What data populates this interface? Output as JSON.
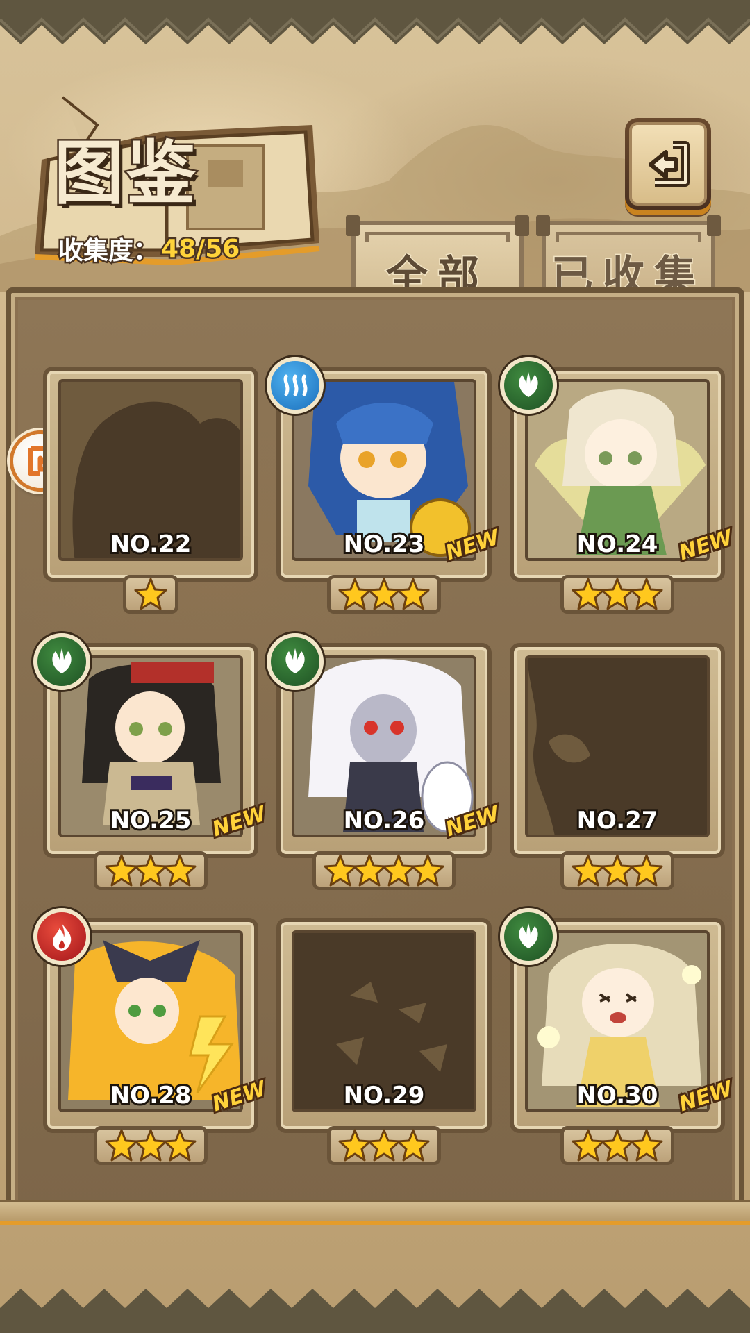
{
  "header": {
    "title": "图鉴",
    "collect_label": "收集度：",
    "collect_value": "48/56"
  },
  "tabs": [
    {
      "label": "全部",
      "active": true
    },
    {
      "label": "已收集",
      "active": false
    }
  ],
  "icons": {
    "back": "back-return-icon",
    "side_arrow": "prev-page-arrow-icon",
    "water": "water-element-icon",
    "nature": "nature-leaf-element-icon",
    "fire": "fire-element-icon",
    "star": "star-icon"
  },
  "colors": {
    "accent_orange": "#e49c2a",
    "gold_text": "#ffd43a",
    "frame_brown": "#6a5439",
    "water": "#1b6fbc",
    "nature": "#1f5224",
    "fire": "#a3161a"
  },
  "new_badge_label": "NEW",
  "cards": [
    {
      "number": "NO.22",
      "stars": 1,
      "element": null,
      "new": false,
      "collected": false
    },
    {
      "number": "NO.23",
      "stars": 3,
      "element": "water",
      "new": true,
      "collected": true
    },
    {
      "number": "NO.24",
      "stars": 3,
      "element": "nature",
      "new": true,
      "collected": true
    },
    {
      "number": "NO.25",
      "stars": 3,
      "element": "nature",
      "new": true,
      "collected": true
    },
    {
      "number": "NO.26",
      "stars": 4,
      "element": "nature",
      "new": true,
      "collected": true
    },
    {
      "number": "NO.27",
      "stars": 3,
      "element": null,
      "new": false,
      "collected": false
    },
    {
      "number": "NO.28",
      "stars": 3,
      "element": "fire",
      "new": true,
      "collected": true
    },
    {
      "number": "NO.29",
      "stars": 3,
      "element": null,
      "new": false,
      "collected": false
    },
    {
      "number": "NO.30",
      "stars": 3,
      "element": "nature",
      "new": true,
      "collected": true
    }
  ]
}
